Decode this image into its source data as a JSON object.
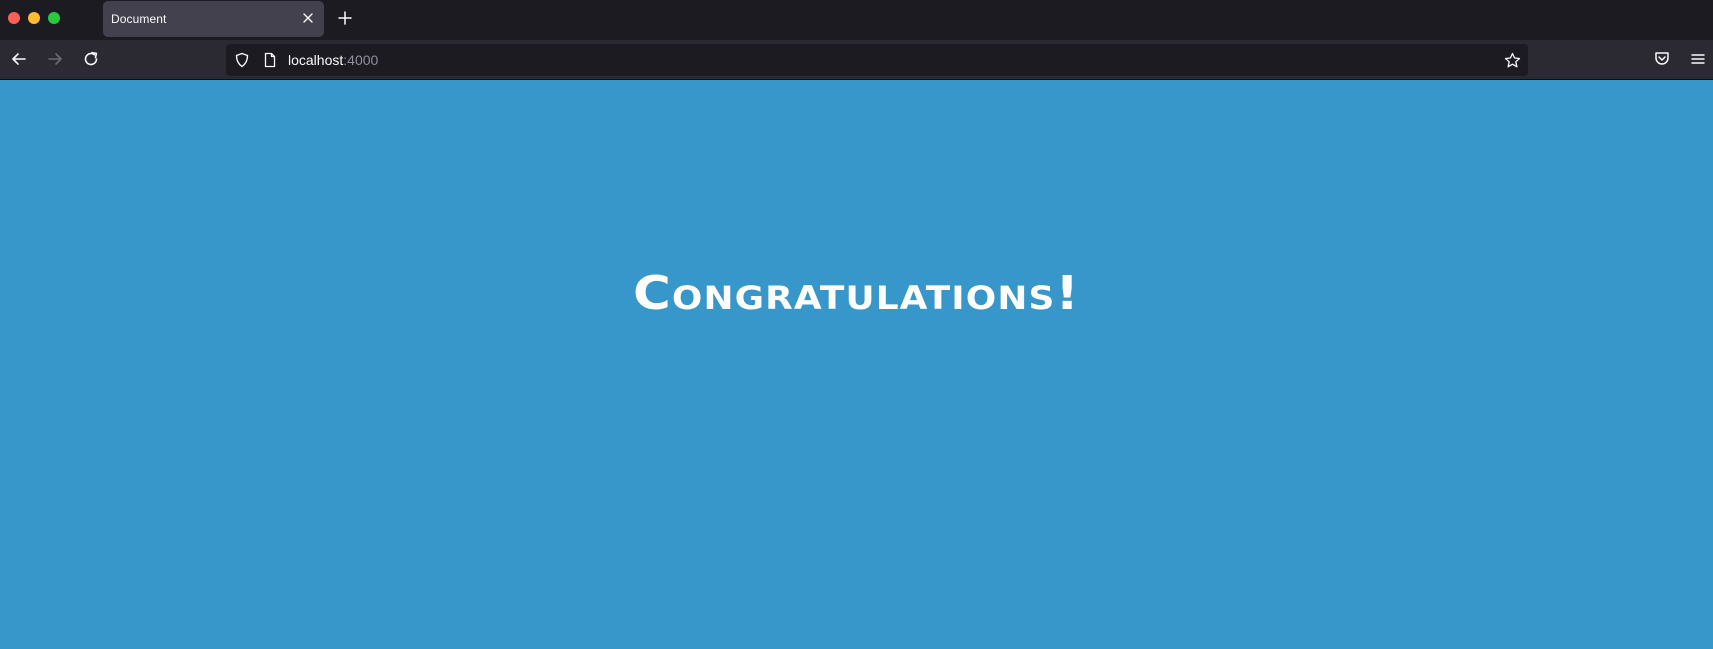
{
  "browser": {
    "tab": {
      "title": "Document"
    },
    "urlbar": {
      "host": "localhost",
      "port": ":4000"
    },
    "icons": {
      "close_tab": "close-icon",
      "new_tab": "plus-icon",
      "back": "back-arrow-icon",
      "forward": "forward-arrow-icon",
      "reload": "reload-icon",
      "tracking_protection": "shield-icon",
      "page_info": "page-icon",
      "bookmark": "star-icon",
      "pocket": "pocket-icon",
      "menu": "hamburger-menu-icon"
    }
  },
  "page": {
    "headline": "Congratulations!",
    "background_color": "#3897ca"
  }
}
